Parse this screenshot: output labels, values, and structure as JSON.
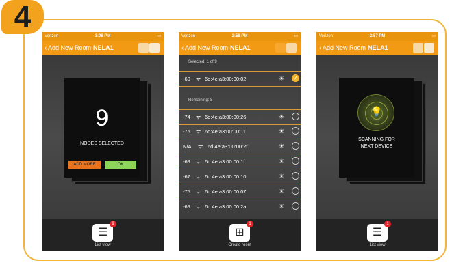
{
  "step": "4",
  "phones": [
    {
      "status": {
        "carrier": "Verizon",
        "time": "3:08 PM",
        "battery": "battery"
      },
      "nav": {
        "back": "Add New Room",
        "title": "NELA1"
      },
      "card": {
        "count": "9",
        "label": "NODES SELECTED",
        "add_more": "ADD MORE",
        "ok": "OK"
      },
      "bottom": {
        "label": "List view",
        "badge": "9"
      }
    },
    {
      "status": {
        "carrier": "Verizon",
        "time": "2:58 PM",
        "battery": "battery"
      },
      "nav": {
        "back": "Add New Room",
        "title": "NELA1"
      },
      "selected_label": "Selected: 1 of 9",
      "selected": [
        {
          "rssi": "-60",
          "mac": "6d:4e:a3:00:00:02",
          "checked": true
        }
      ],
      "remaining_label": "Remaining: 8",
      "remaining": [
        {
          "rssi": "-74",
          "mac": "6d:4e:a3:00:00:26"
        },
        {
          "rssi": "-75",
          "mac": "6d:4e:a3:00:00:11"
        },
        {
          "rssi": "N/A",
          "mac": "6d:4e:a3:00:00:2f"
        },
        {
          "rssi": "-69",
          "mac": "6d:4e:a3:00:00:1f"
        },
        {
          "rssi": "-67",
          "mac": "6d:4e:a3:00:00:10"
        },
        {
          "rssi": "-75",
          "mac": "6d:4e:a3:00:00:07"
        },
        {
          "rssi": "-69",
          "mac": "6d:4e:a3:00:00:2a"
        }
      ],
      "bottom": {
        "label": "Create room",
        "badge": "1"
      }
    },
    {
      "status": {
        "carrier": "Verizon",
        "time": "2:57 PM",
        "battery": "battery"
      },
      "nav": {
        "back": "Add New Room",
        "title": "NELA1"
      },
      "scan": {
        "line1": "SCANNING FOR",
        "line2": "NEXT DEVICE"
      },
      "bottom": {
        "label": "List view",
        "badge": "1"
      }
    }
  ],
  "icons": {
    "wifi": "wifi-icon",
    "sun": "sun-icon",
    "list": "list-icon",
    "create": "add-room-icon",
    "bulb": "bulb-icon"
  },
  "colors": {
    "accent": "#f29a14",
    "frame": "#f2b53a",
    "badge": "#e2232a",
    "ok": "#8fd35a",
    "add_more": "#e8731f"
  }
}
